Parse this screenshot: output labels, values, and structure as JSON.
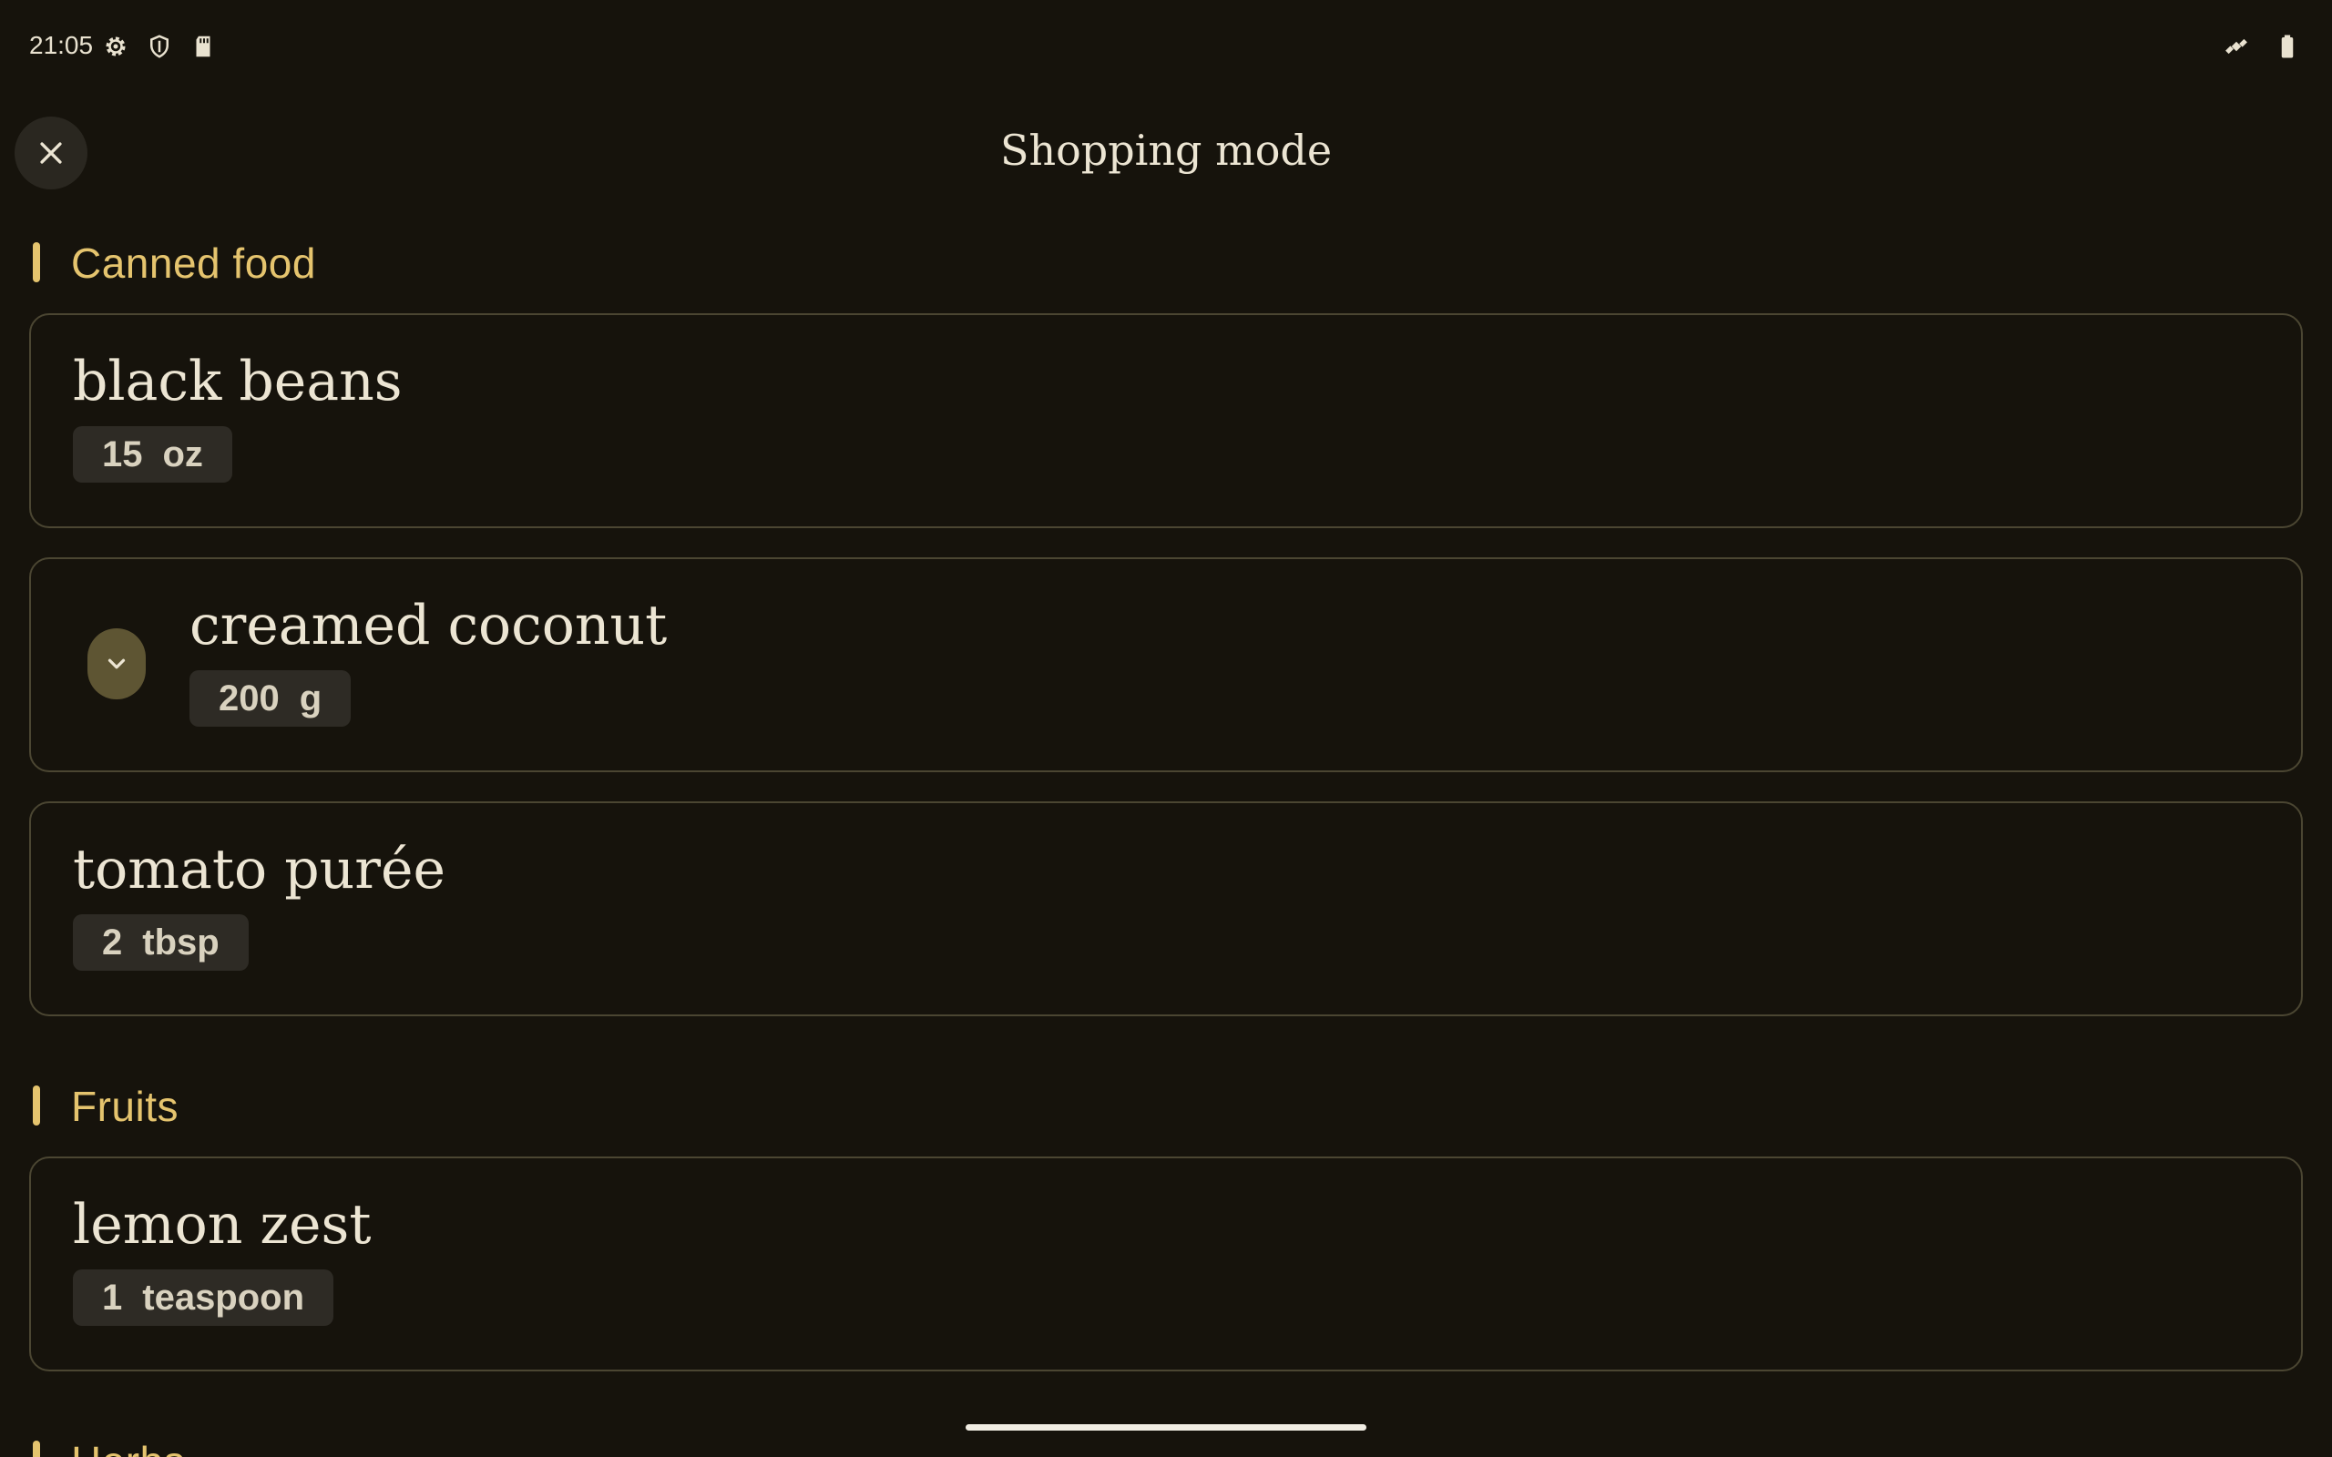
{
  "status_bar": {
    "time": "21:05",
    "left_icons": [
      "settings-icon",
      "shield-icon",
      "sd-card-icon"
    ],
    "right_icons": [
      "satellite-icon",
      "battery-icon"
    ]
  },
  "app_bar": {
    "title": "Shopping mode",
    "close_icon": "close-icon"
  },
  "sections": [
    {
      "title": "Canned food",
      "items": [
        {
          "name": "black beans",
          "amount": "15",
          "unit": "oz",
          "expandable": false
        },
        {
          "name": "creamed coconut",
          "amount": "200",
          "unit": "g",
          "expandable": true
        },
        {
          "name": "tomato purée",
          "amount": "2",
          "unit": "tbsp",
          "expandable": false
        }
      ]
    },
    {
      "title": "Fruits",
      "items": [
        {
          "name": "lemon zest",
          "amount": "1",
          "unit": "teaspoon",
          "expandable": false
        }
      ]
    },
    {
      "title": "Herbs",
      "items": []
    }
  ],
  "colors": {
    "background": "#16130c",
    "accent": "#e5c46e",
    "card_border": "#4b4632",
    "chip_bg": "#2e2b25",
    "expand_bg": "#5e5533"
  }
}
